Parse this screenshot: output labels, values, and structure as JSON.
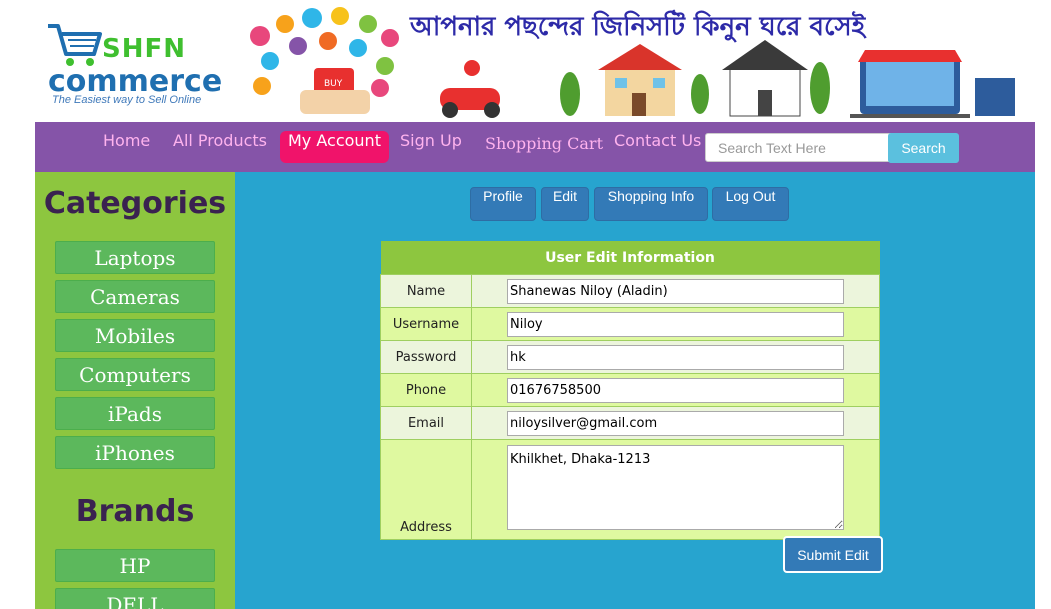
{
  "header": {
    "brand_top": "SHFN",
    "brand_main": "commerce",
    "tagline": "The Easiest way to Sell Online",
    "banner_text": "আপনার পছন্দের জিনিসটি কিনুন ঘরে বসেই"
  },
  "nav": {
    "items": [
      {
        "label": "Home"
      },
      {
        "label": "All Products"
      },
      {
        "label": "My Account",
        "active": true
      },
      {
        "label": "Sign Up"
      },
      {
        "label": "Shopping Cart"
      },
      {
        "label": "Contact Us"
      }
    ],
    "search_placeholder": "Search Text Here",
    "search_label": "Search"
  },
  "sidebar": {
    "categories_title": "Categories",
    "categories": [
      "Laptops",
      "Cameras",
      "Mobiles",
      "Computers",
      "iPads",
      "iPhones"
    ],
    "brands_title": "Brands",
    "brands": [
      "HP",
      "DELL"
    ]
  },
  "account_tabs": [
    "Profile",
    "Edit",
    "Shopping Info",
    "Log Out"
  ],
  "form": {
    "title": "User Edit Information",
    "fields": [
      {
        "label": "Name",
        "value": "Shanewas Niloy (Aladin)"
      },
      {
        "label": "Username",
        "value": "Niloy"
      },
      {
        "label": "Password",
        "value": "hk"
      },
      {
        "label": "Phone",
        "value": "01676758500"
      },
      {
        "label": "Email",
        "value": "niloysilver@gmail.com"
      }
    ],
    "address_label": "Address",
    "address_value": "Khilkhet, Dhaka-1213",
    "submit_label": "Submit Edit"
  },
  "colors": {
    "nav_bg": "#8554a8",
    "active_tab": "#f0136a",
    "sidebar_bg": "#8dc63f",
    "main_bg": "#27a4cf",
    "button_blue": "#337ab7"
  }
}
